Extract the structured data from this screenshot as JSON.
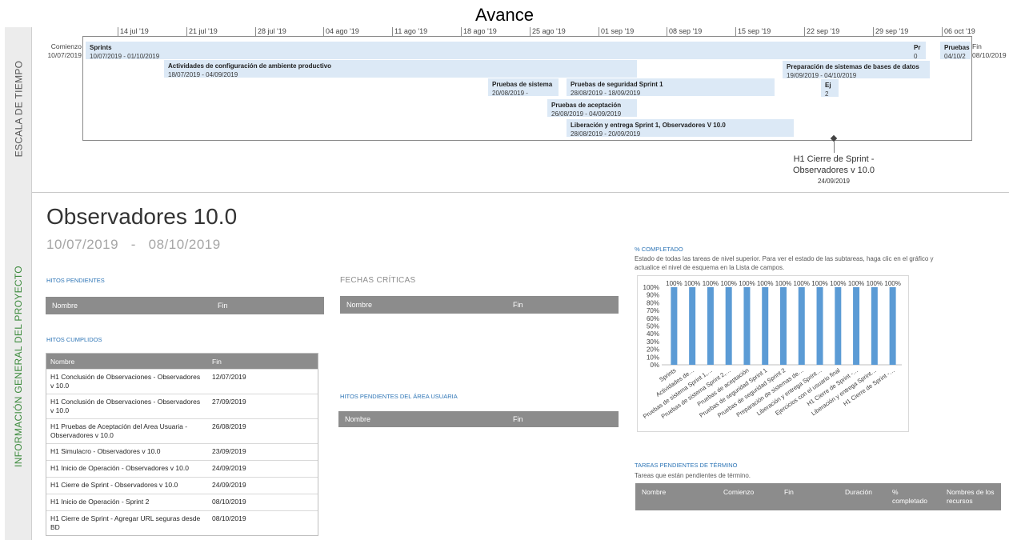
{
  "page_title": "Avance",
  "side_labels": {
    "timeline": "ESCALA DE TIEMPO",
    "info": "INFORMACIÓN GENERAL DEL PROYECTO"
  },
  "timeline": {
    "ticks": [
      "14 jul '19",
      "21 jul '19",
      "28 jul '19",
      "04 ago '19",
      "11 ago '19",
      "18 ago '19",
      "25 ago '19",
      "01 sep '19",
      "08 sep '19",
      "15 sep '19",
      "22 sep '19",
      "29 sep '19",
      "06 oct '19"
    ],
    "start_label": "Comienzo",
    "start_date": "10/07/2019",
    "end_label": "Fin",
    "end_date": "08/10/2019",
    "bars": [
      {
        "title": "Sprints",
        "dates": "10/07/2019 - 01/10/2019"
      },
      {
        "title": "Actividades de configuración de ambiente productivo",
        "dates": "18/07/2019 - 04/09/2019"
      },
      {
        "title": "Pruebas de sistema",
        "dates": "20/08/2019 -"
      },
      {
        "title": "Pruebas de seguridad Sprint 1",
        "dates": "28/08/2019 - 18/09/2019"
      },
      {
        "title": "Pruebas de aceptación",
        "dates": "26/08/2019 - 04/09/2019"
      },
      {
        "title": "Liberación y entrega Sprint 1, Observadores V 10.0",
        "dates": "28/08/2019 - 20/09/2019"
      },
      {
        "title": "Preparación de sistemas de bases de datos",
        "dates": "19/09/2019 - 04/10/2019"
      },
      {
        "title": "Ej",
        "dates": "2"
      },
      {
        "title": "Pr",
        "dates": "0"
      },
      {
        "title": "Pruebas",
        "dates": "04/10/2"
      }
    ],
    "milestone": {
      "label": "H1 Cierre de Sprint - Observadores v 10.0",
      "date": "24/09/2019"
    }
  },
  "project": {
    "name": "Observadores 10.0",
    "start": "10/07/2019",
    "sep": "-",
    "end": "08/10/2019"
  },
  "pending_milestones": {
    "title": "HITOS PENDIENTES",
    "col_name": "Nombre",
    "col_end": "Fin"
  },
  "critical_dates": {
    "title": "FECHAS CRÍTICAS",
    "col_name": "Nombre",
    "col_end": "Fin"
  },
  "user_area_pending": {
    "title": "HITOS PENDIENTES DEL ÁREA USUARIA",
    "col_name": "Nombre",
    "col_end": "Fin"
  },
  "achieved_milestones": {
    "title": "HITOS CUMPLIDOS",
    "col_name": "Nombre",
    "col_end": "Fin",
    "rows": [
      {
        "name": "H1 Conclusión de Observaciones - Observadores v 10.0",
        "end": "12/07/2019"
      },
      {
        "name": "H1 Conclusión de Observaciones - Observadores v 10.0",
        "end": "27/09/2019"
      },
      {
        "name": "H1 Pruebas de Aceptación del Area Usuaria - Observadores v 10.0",
        "end": "26/08/2019"
      },
      {
        "name": "H1 Simulacro - Observadores v 10.0",
        "end": "23/09/2019"
      },
      {
        "name": "H1 Inicio de Operación - Observadores v 10.0",
        "end": "24/09/2019"
      },
      {
        "name": "H1 Cierre de Sprint - Observadores v 10.0",
        "end": "24/09/2019"
      },
      {
        "name": "H1 Inicio de Operación - Sprint 2",
        "end": "08/10/2019"
      },
      {
        "name": "H1 Cierre de Sprint - Agregar URL seguras desde BD",
        "end": "08/10/2019"
      }
    ]
  },
  "percent_complete": {
    "title": "% COMPLETADO",
    "description": "Estado de todas las tareas de nivel superior. Para ver el estado de las subtareas, haga clic en el gráfico y actualice el nivel de esquema en la Lista de campos."
  },
  "chart_data": {
    "type": "bar",
    "categories": [
      "Sprints",
      "Actividades de…",
      "Pruebas de sistema Sprint 1,…",
      "Pruebas de sistema Sprint 2,…",
      "Pruebas de aceptación",
      "Pruebas de seguridad Sprint 1",
      "Pruebas de seguridad Sprint 2",
      "Preparación de sistemas de…",
      "Liberación y entrega Sprint…",
      "Ejercicios con el usuario final",
      "H1 Cierre de Sprint -…",
      "Liberación y entrega Sprint…",
      "H1 Cierre de Sprint -…"
    ],
    "values": [
      100,
      100,
      100,
      100,
      100,
      100,
      100,
      100,
      100,
      100,
      100,
      100,
      100
    ],
    "value_labels": [
      "100%",
      "100%",
      "100%",
      "100%",
      "100%",
      "100%",
      "100%",
      "100%",
      "100%",
      "100%",
      "100%",
      "100%",
      "100%"
    ],
    "ylim": [
      0,
      100
    ],
    "yticks": [
      "0%",
      "10%",
      "20%",
      "30%",
      "40%",
      "50%",
      "60%",
      "70%",
      "80%",
      "90%",
      "100%"
    ],
    "bar_color": "#5b9bd5",
    "grid": false
  },
  "pending_tasks": {
    "title": "TAREAS PENDIENTES DE TÉRMINO",
    "description": "Tareas que están pendientes de término.",
    "cols": [
      "Nombre",
      "Comienzo",
      "Fin",
      "Duración",
      "% completado",
      "Nombres de los recursos"
    ]
  }
}
